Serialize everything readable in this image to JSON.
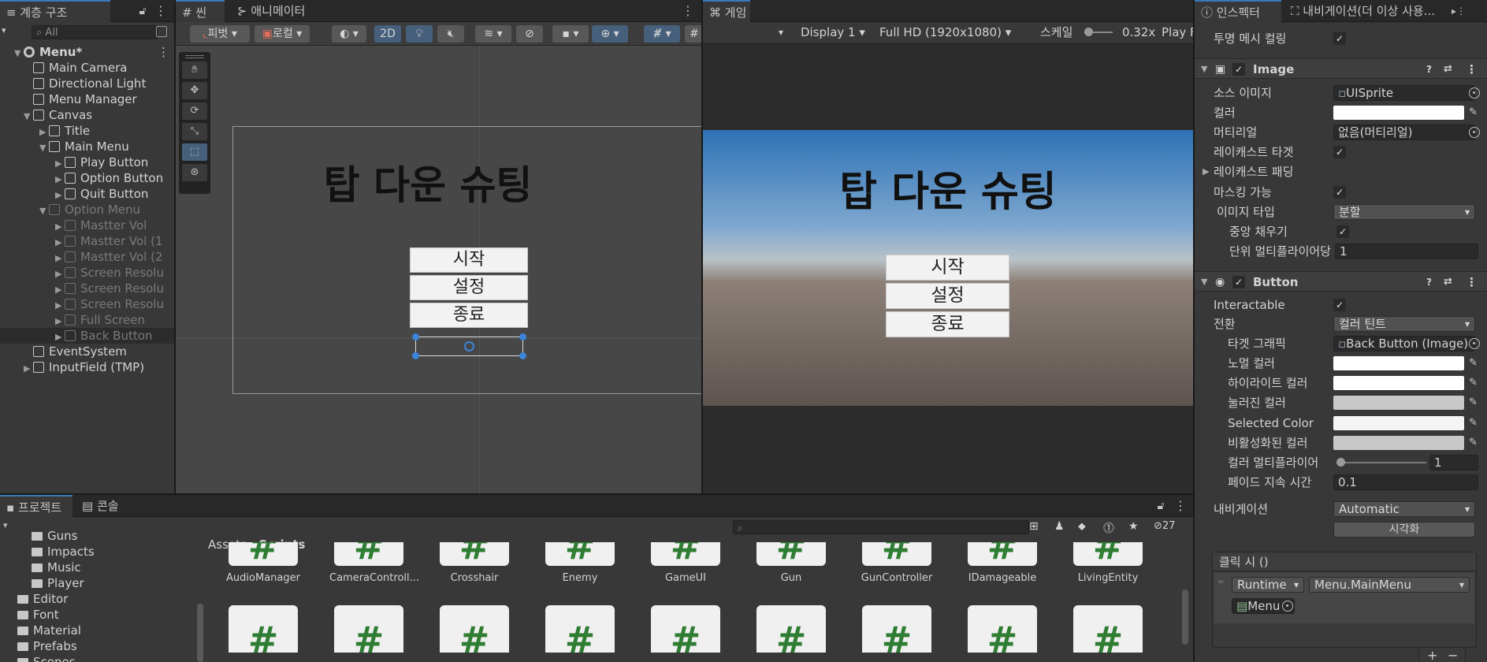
{
  "hierarchy": {
    "tab": "계층 구조",
    "search_placeholder": "All",
    "items": [
      {
        "label": "Menu*",
        "bold": true
      },
      {
        "label": "Main Camera"
      },
      {
        "label": "Directional Light"
      },
      {
        "label": "Menu Manager"
      },
      {
        "label": "Canvas"
      },
      {
        "label": "Title"
      },
      {
        "label": "Main Menu"
      },
      {
        "label": "Play Button"
      },
      {
        "label": "Option Button"
      },
      {
        "label": "Quit Button"
      },
      {
        "label": "Option Menu"
      },
      {
        "label": "Mastter Vol"
      },
      {
        "label": "Mastter Vol (1"
      },
      {
        "label": "Mastter Vol (2"
      },
      {
        "label": "Screen Resolu"
      },
      {
        "label": "Screen Resolu"
      },
      {
        "label": "Screen Resolu"
      },
      {
        "label": "Full Screen"
      },
      {
        "label": "Back Button"
      },
      {
        "label": "EventSystem"
      },
      {
        "label": "InputField (TMP)"
      }
    ]
  },
  "scene": {
    "tab_scene": "씬",
    "tab_animator": "애니메이터",
    "pivot": "피벗",
    "local": "로컬",
    "mode_2d": "2D",
    "title": "탑 다운 슈팅",
    "buttons": [
      "시작",
      "설정",
      "종료"
    ]
  },
  "game": {
    "tab": "게임",
    "display": "Display 1",
    "resolution": "Full HD (1920x1080)",
    "scale_label": "스케일",
    "scale_value": "0.32x",
    "play": "Play F",
    "title": "탑 다운 슈팅",
    "buttons": [
      "시작",
      "설정",
      "종료"
    ]
  },
  "inspector": {
    "tab": "인스펙터",
    "tab_nav": "내비게이션(더 이상 사용...",
    "culling_label": "투명 메시 컬링",
    "image": {
      "header": "Image",
      "source_label": "소스 이미지",
      "source_value": "UISprite",
      "color_label": "컬러",
      "color_value": "#ffffff",
      "material_label": "머티리얼",
      "material_value": "없음(머티리얼)",
      "raycast_target_label": "레이캐스트 타겟",
      "raycast_padding_label": "레이캐스트 패딩",
      "maskable_label": "마스킹 가능",
      "image_type_label": "이미지 타입",
      "image_type_value": "분할",
      "fill_center_label": "중앙 채우기",
      "ppu_label": "단위 멀티플라이어당 픽셀",
      "ppu_value": "1"
    },
    "button": {
      "header": "Button",
      "interactable_label": "Interactable",
      "transition_label": "전환",
      "transition_value": "컬러 틴트",
      "target_graphic_label": "타겟 그래픽",
      "target_graphic_value": "Back Button (Image)",
      "normal_label": "노멀 컬러",
      "highlight_label": "하이라이트 컬러",
      "pressed_label": "눌러진 컬러",
      "selected_label": "Selected Color",
      "disabled_label": "비활성화된 컬러",
      "multiplier_label": "컬러 멀티플라이어",
      "multiplier_value": "1",
      "fade_label": "페이드 지속 시간",
      "fade_value": "0.1",
      "navigation_label": "내비게이션",
      "navigation_value": "Automatic",
      "visualize": "시각화",
      "onclick_label": "클릭 시 ()",
      "runtime": "Runtime",
      "method": "Menu.MainMenu",
      "object": "Menu",
      "colors": {
        "normal": "#ffffff",
        "highlight": "#ffffff",
        "pressed": "#c8c8c8",
        "selected": "#f5f5f5",
        "disabled": "#c8c8c8"
      }
    }
  },
  "project": {
    "tab_project": "프로젝트",
    "tab_console": "콘솔",
    "hidden_count": "27",
    "folders": [
      {
        "label": "Guns",
        "indent": 2
      },
      {
        "label": "Impacts",
        "indent": 2
      },
      {
        "label": "Music",
        "indent": 2
      },
      {
        "label": "Player",
        "indent": 2
      },
      {
        "label": "Editor",
        "indent": 1
      },
      {
        "label": "Font",
        "indent": 1
      },
      {
        "label": "Material",
        "indent": 1
      },
      {
        "label": "Prefabs",
        "indent": 1
      },
      {
        "label": "Scenes",
        "indent": 1
      }
    ],
    "breadcrumb_root": "Assets",
    "breadcrumb_current": "Scripts",
    "assets": [
      "AudioManager",
      "CameraControll...",
      "Crosshair",
      "Enemy",
      "GameUI",
      "Gun",
      "GunController",
      "IDamageable",
      "LivingEntity"
    ]
  }
}
